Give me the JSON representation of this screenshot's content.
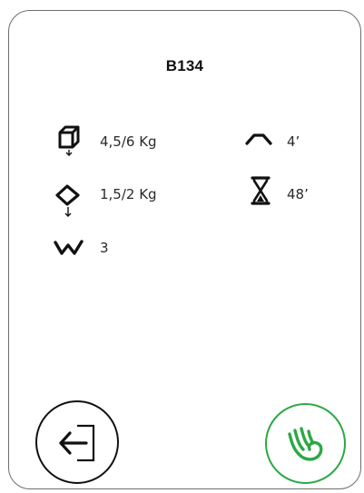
{
  "program": {
    "title": "B134"
  },
  "specs": {
    "load_cotton": "4,5/6 Kg",
    "load_synthetic": "1,5/2 Kg",
    "wash_count": "3",
    "iron_time": "4’",
    "duration": "48’"
  },
  "buttons": {
    "back": {
      "icon": "exit-door-arrow-icon"
    },
    "confirm": {
      "icon": "hand-gesture-icon",
      "color": "#2ca845"
    }
  }
}
